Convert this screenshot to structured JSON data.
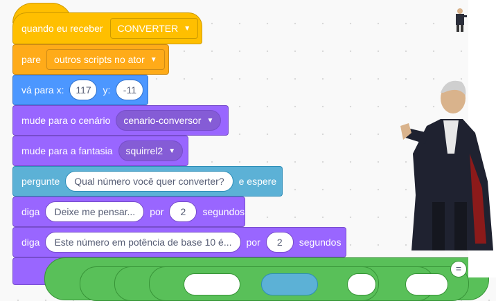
{
  "blocks": {
    "when_receive": {
      "label": "quando eu receber",
      "message": "CONVERTER"
    },
    "stop": {
      "label": "pare",
      "option": "outros scripts no ator"
    },
    "goto": {
      "label": "vá para x:",
      "x": "117",
      "ylabel": "y:",
      "y": "-11"
    },
    "switch_backdrop": {
      "label": "mude para o cenário",
      "backdrop": "cenario-conversor"
    },
    "switch_costume": {
      "label": "mude para a fantasia",
      "costume": "squirrel2"
    },
    "ask": {
      "label": "pergunte",
      "question": "Qual número você quer converter?",
      "suffix": "e espere"
    },
    "say1": {
      "label": "diga",
      "message": "Deixe me pensar...",
      "por": "por",
      "secs": "2",
      "unit": "segundos"
    },
    "say2": {
      "label": "diga",
      "message": "Este número em potência de base 10 é...",
      "por": "por",
      "secs": "2",
      "unit": "segundos"
    },
    "equals": "="
  },
  "colors": {
    "events": "#ffbf00",
    "control": "#ffab19",
    "motion": "#4c97ff",
    "looks": "#9966ff",
    "sensing": "#5cb1d6",
    "operators": "#59c059"
  },
  "icons": {
    "dropdown": "caret-down-icon",
    "sprite": "doctor-sprite-image"
  }
}
